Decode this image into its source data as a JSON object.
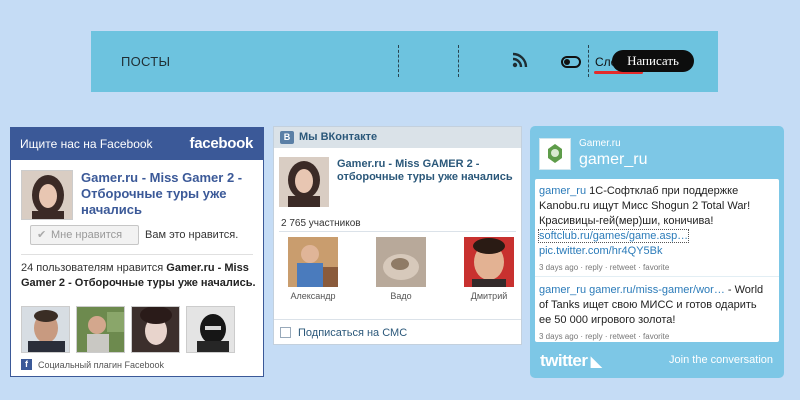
{
  "header": {
    "posts_label": "ПОСТЫ",
    "follow_label": "Следить",
    "write_label": "Написать",
    "rss_icon": "rss-icon",
    "toggle_icon": "toggle-icon"
  },
  "facebook": {
    "header_title": "Ищите нас на Facebook",
    "logo": "facebook",
    "page_name": "Gamer.ru - Miss Gamer 2 - Отборочные туры уже начались",
    "like_button": "Мне нравится",
    "like_note": "Вам это нравится.",
    "likers_prefix": "24 пользователям нравится ",
    "likers_page": "Gamer.ru - Miss Gamer 2 - Отборочные туры уже начались.",
    "footer": "Социальный плагин Facebook",
    "brand_color": "#3b5998"
  },
  "vk": {
    "title": "Мы ВКонтакте",
    "page_name": "Gamer.ru - Miss GAMER 2 - отборочные туры уже начались",
    "members_count": "2 765 участников",
    "members": [
      {
        "name": "Александр"
      },
      {
        "name": "Вадо"
      },
      {
        "name": "Дмитрий"
      }
    ],
    "subscribe_sms": "Подписаться на СМС"
  },
  "twitter": {
    "account_small": "Gamer.ru",
    "handle": "gamer_ru",
    "tweets": [
      {
        "author": "gamer_ru",
        "text": " 1С-Софтклаб при поддержке Kanobu.ru ищут Мисс Shogun 2 Total War! Красивицы-гей(мер)ши, коничива! ",
        "link1": "softclub.ru/games/game.asp…",
        "link2": "pic.twitter.com/hr4QY5Bk",
        "meta": "3 days ago · reply · retweet · favorite"
      },
      {
        "author": "gamer_ru",
        "link1": "gamer.ru/miss-gamer/wor…",
        "text": " - World of Tanks ищет свою МИСС и готов одарить ее 50 000 игрового золота!",
        "meta": "3 days ago · reply · retweet · favorite"
      }
    ],
    "logo": "twitter",
    "join": "Join the conversation",
    "bg_color": "#7dc7e6"
  }
}
